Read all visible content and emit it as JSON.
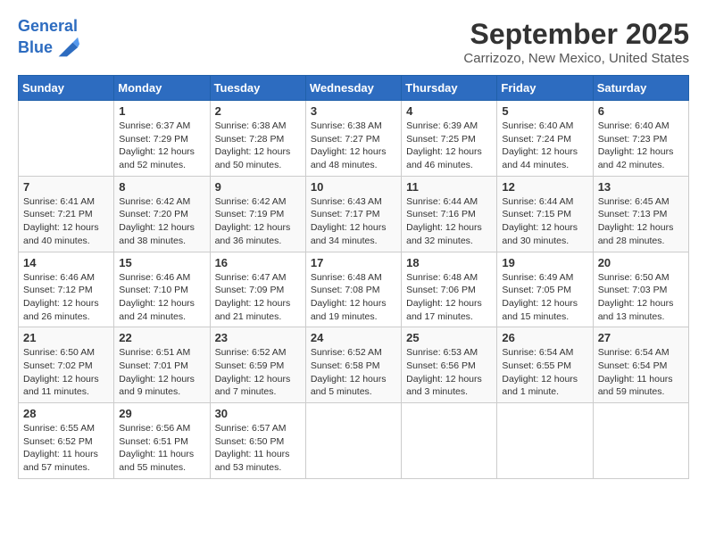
{
  "header": {
    "logo_line1": "General",
    "logo_line2": "Blue",
    "title": "September 2025",
    "subtitle": "Carrizozo, New Mexico, United States"
  },
  "weekdays": [
    "Sunday",
    "Monday",
    "Tuesday",
    "Wednesday",
    "Thursday",
    "Friday",
    "Saturday"
  ],
  "weeks": [
    [
      {
        "day": "",
        "info": ""
      },
      {
        "day": "1",
        "info": "Sunrise: 6:37 AM\nSunset: 7:29 PM\nDaylight: 12 hours\nand 52 minutes."
      },
      {
        "day": "2",
        "info": "Sunrise: 6:38 AM\nSunset: 7:28 PM\nDaylight: 12 hours\nand 50 minutes."
      },
      {
        "day": "3",
        "info": "Sunrise: 6:38 AM\nSunset: 7:27 PM\nDaylight: 12 hours\nand 48 minutes."
      },
      {
        "day": "4",
        "info": "Sunrise: 6:39 AM\nSunset: 7:25 PM\nDaylight: 12 hours\nand 46 minutes."
      },
      {
        "day": "5",
        "info": "Sunrise: 6:40 AM\nSunset: 7:24 PM\nDaylight: 12 hours\nand 44 minutes."
      },
      {
        "day": "6",
        "info": "Sunrise: 6:40 AM\nSunset: 7:23 PM\nDaylight: 12 hours\nand 42 minutes."
      }
    ],
    [
      {
        "day": "7",
        "info": "Sunrise: 6:41 AM\nSunset: 7:21 PM\nDaylight: 12 hours\nand 40 minutes."
      },
      {
        "day": "8",
        "info": "Sunrise: 6:42 AM\nSunset: 7:20 PM\nDaylight: 12 hours\nand 38 minutes."
      },
      {
        "day": "9",
        "info": "Sunrise: 6:42 AM\nSunset: 7:19 PM\nDaylight: 12 hours\nand 36 minutes."
      },
      {
        "day": "10",
        "info": "Sunrise: 6:43 AM\nSunset: 7:17 PM\nDaylight: 12 hours\nand 34 minutes."
      },
      {
        "day": "11",
        "info": "Sunrise: 6:44 AM\nSunset: 7:16 PM\nDaylight: 12 hours\nand 32 minutes."
      },
      {
        "day": "12",
        "info": "Sunrise: 6:44 AM\nSunset: 7:15 PM\nDaylight: 12 hours\nand 30 minutes."
      },
      {
        "day": "13",
        "info": "Sunrise: 6:45 AM\nSunset: 7:13 PM\nDaylight: 12 hours\nand 28 minutes."
      }
    ],
    [
      {
        "day": "14",
        "info": "Sunrise: 6:46 AM\nSunset: 7:12 PM\nDaylight: 12 hours\nand 26 minutes."
      },
      {
        "day": "15",
        "info": "Sunrise: 6:46 AM\nSunset: 7:10 PM\nDaylight: 12 hours\nand 24 minutes."
      },
      {
        "day": "16",
        "info": "Sunrise: 6:47 AM\nSunset: 7:09 PM\nDaylight: 12 hours\nand 21 minutes."
      },
      {
        "day": "17",
        "info": "Sunrise: 6:48 AM\nSunset: 7:08 PM\nDaylight: 12 hours\nand 19 minutes."
      },
      {
        "day": "18",
        "info": "Sunrise: 6:48 AM\nSunset: 7:06 PM\nDaylight: 12 hours\nand 17 minutes."
      },
      {
        "day": "19",
        "info": "Sunrise: 6:49 AM\nSunset: 7:05 PM\nDaylight: 12 hours\nand 15 minutes."
      },
      {
        "day": "20",
        "info": "Sunrise: 6:50 AM\nSunset: 7:03 PM\nDaylight: 12 hours\nand 13 minutes."
      }
    ],
    [
      {
        "day": "21",
        "info": "Sunrise: 6:50 AM\nSunset: 7:02 PM\nDaylight: 12 hours\nand 11 minutes."
      },
      {
        "day": "22",
        "info": "Sunrise: 6:51 AM\nSunset: 7:01 PM\nDaylight: 12 hours\nand 9 minutes."
      },
      {
        "day": "23",
        "info": "Sunrise: 6:52 AM\nSunset: 6:59 PM\nDaylight: 12 hours\nand 7 minutes."
      },
      {
        "day": "24",
        "info": "Sunrise: 6:52 AM\nSunset: 6:58 PM\nDaylight: 12 hours\nand 5 minutes."
      },
      {
        "day": "25",
        "info": "Sunrise: 6:53 AM\nSunset: 6:56 PM\nDaylight: 12 hours\nand 3 minutes."
      },
      {
        "day": "26",
        "info": "Sunrise: 6:54 AM\nSunset: 6:55 PM\nDaylight: 12 hours\nand 1 minute."
      },
      {
        "day": "27",
        "info": "Sunrise: 6:54 AM\nSunset: 6:54 PM\nDaylight: 11 hours\nand 59 minutes."
      }
    ],
    [
      {
        "day": "28",
        "info": "Sunrise: 6:55 AM\nSunset: 6:52 PM\nDaylight: 11 hours\nand 57 minutes."
      },
      {
        "day": "29",
        "info": "Sunrise: 6:56 AM\nSunset: 6:51 PM\nDaylight: 11 hours\nand 55 minutes."
      },
      {
        "day": "30",
        "info": "Sunrise: 6:57 AM\nSunset: 6:50 PM\nDaylight: 11 hours\nand 53 minutes."
      },
      {
        "day": "",
        "info": ""
      },
      {
        "day": "",
        "info": ""
      },
      {
        "day": "",
        "info": ""
      },
      {
        "day": "",
        "info": ""
      }
    ]
  ]
}
